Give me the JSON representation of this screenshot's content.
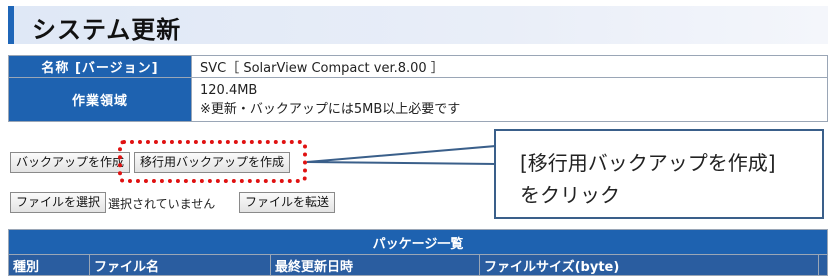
{
  "header": {
    "title": "システム更新"
  },
  "info": {
    "rows": [
      {
        "label": "名称 [バージョン]",
        "value": "SVC［ SolarView Compact ver.8.00 ］"
      },
      {
        "label": "作業領域",
        "value": "120.4MB",
        "note": "※更新・バックアップには5MB以上必要です"
      }
    ]
  },
  "buttons": {
    "backup": "バックアップを作成",
    "migration_backup": "移行用バックアップを作成",
    "choose_file": "ファイルを選択",
    "transfer_file": "ファイルを転送"
  },
  "file_status": "選択されていません",
  "callout": {
    "line1": "[移行用バックアップを作成]",
    "line2": "をクリック"
  },
  "package_list": {
    "title": "パッケージ一覧",
    "columns": [
      "種別",
      "ファイル名",
      "最終更新日時",
      "ファイルサイズ(byte)"
    ]
  },
  "colors": {
    "header_blue": "#1e62b0",
    "highlight_red": "#e01212"
  }
}
